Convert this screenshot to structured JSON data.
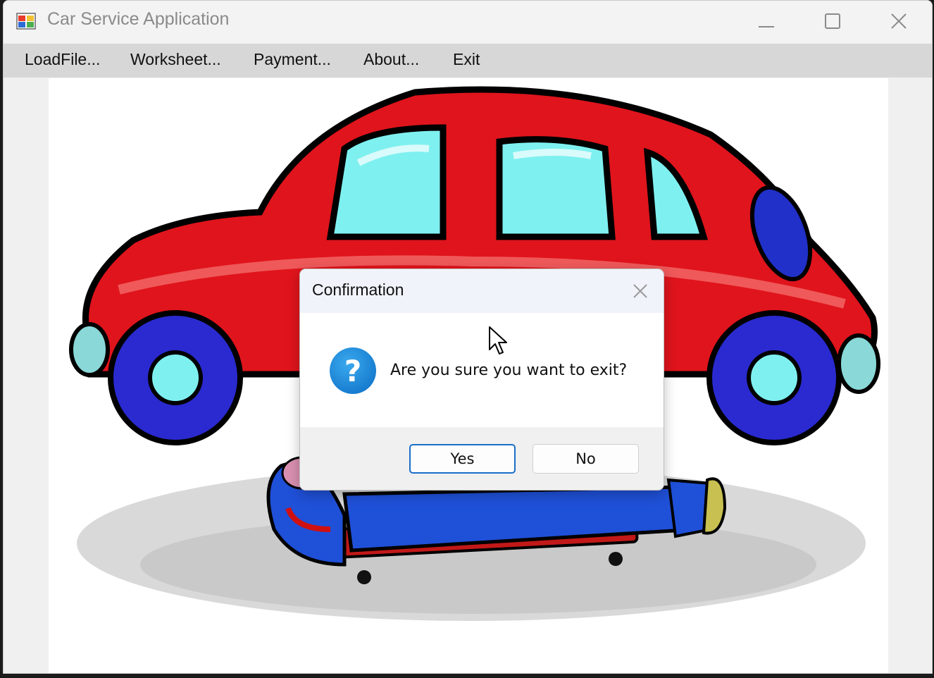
{
  "window": {
    "title": "Car Service Application"
  },
  "menu": {
    "items": [
      {
        "label": "LoadFile..."
      },
      {
        "label": "Worksheet..."
      },
      {
        "label": "Payment..."
      },
      {
        "label": "About..."
      },
      {
        "label": "Exit"
      }
    ]
  },
  "dialog": {
    "title": "Confirmation",
    "message": "Are you sure you want to exit?",
    "icon": "question-icon",
    "yes_label": "Yes",
    "no_label": "No"
  },
  "colors": {
    "car_body": "#e0141c",
    "car_window": "#7ff0f0",
    "wheel": "#2a2ad0",
    "mechanic_suit": "#1f50d8",
    "accent": "#1a6fc9"
  }
}
